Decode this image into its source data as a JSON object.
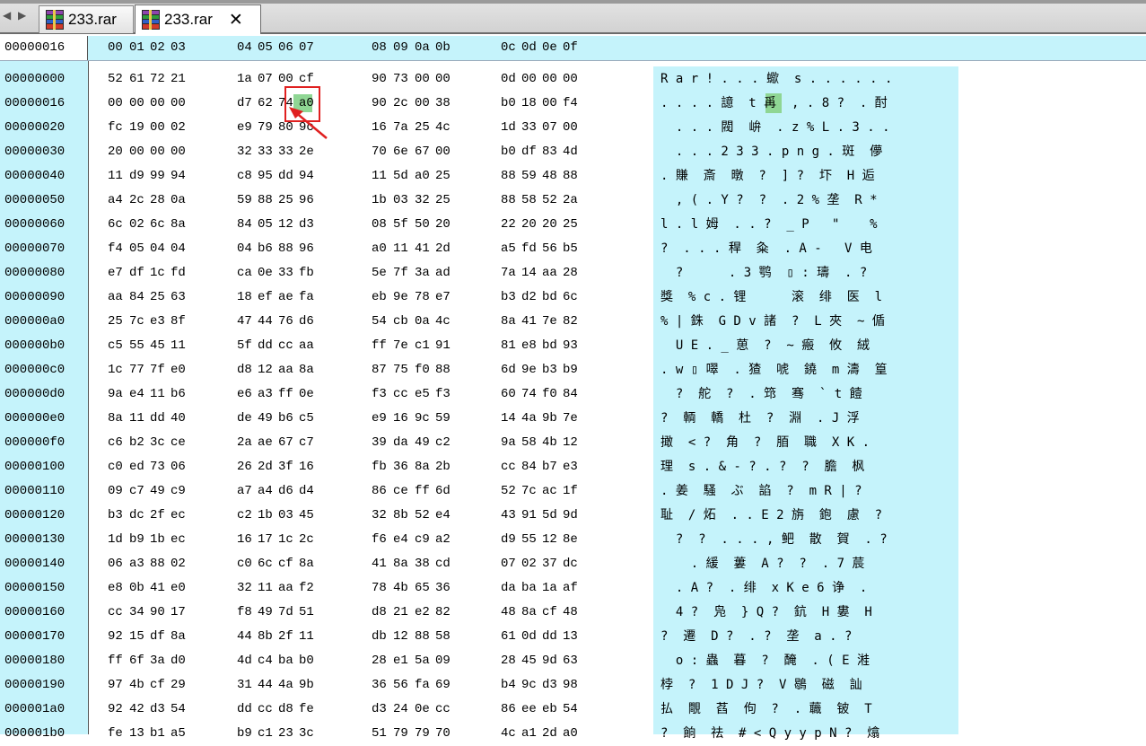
{
  "tabs": [
    {
      "label": "233.rar",
      "active": false
    },
    {
      "label": "233.rar",
      "active": true
    }
  ],
  "nav": {
    "back": "◀",
    "forward": "▶"
  },
  "close_glyph": "✕",
  "header": {
    "offset": "00000016",
    "columns": [
      "00",
      "01",
      "02",
      "03",
      "04",
      "05",
      "06",
      "07",
      "08",
      "09",
      "0a",
      "0b",
      "0c",
      "0d",
      "0e",
      "0f"
    ]
  },
  "rows": [
    {
      "offset": "00000000",
      "hex": [
        "52",
        "61",
        "72",
        "21",
        "1a",
        "07",
        "00",
        "cf",
        "90",
        "73",
        "00",
        "00",
        "0d",
        "00",
        "00",
        "00"
      ],
      "ascii": "R a r ! . . . 蠍  s . . . . . ."
    },
    {
      "offset": "00000016",
      "hex": [
        "00",
        "00",
        "00",
        "00",
        "d7",
        "62",
        "74",
        "a0",
        "90",
        "2c",
        "00",
        "38",
        "b0",
        "18",
        "00",
        "f4"
      ],
      "ascii": ". . . . 譩  t 爯  , . 8 ?  . 酎"
    },
    {
      "offset": "00000020",
      "hex": [
        "fc",
        "19",
        "00",
        "02",
        "e9",
        "79",
        "80",
        "9c",
        "16",
        "7a",
        "25",
        "4c",
        "1d",
        "33",
        "07",
        "00"
      ],
      "ascii": "  . . . 閥  峅  . z % L . 3 . ."
    },
    {
      "offset": "00000030",
      "hex": [
        "20",
        "00",
        "00",
        "00",
        "32",
        "33",
        "33",
        "2e",
        "70",
        "6e",
        "67",
        "00",
        "b0",
        "df",
        "83",
        "4d"
      ],
      "ascii": "  . . . 2 3 3 . p n g . 斑  儚"
    },
    {
      "offset": "00000040",
      "hex": [
        "11",
        "d9",
        "99",
        "94",
        "c8",
        "95",
        "dd",
        "94",
        "11",
        "5d",
        "a0",
        "25",
        "88",
        "59",
        "48",
        "88"
      ],
      "ascii": ". 賺  斎  暾  ?  ] ?  圷  H 逅"
    },
    {
      "offset": "00000050",
      "hex": [
        "a4",
        "2c",
        "28",
        "0a",
        "59",
        "88",
        "25",
        "96",
        "1b",
        "03",
        "32",
        "25",
        "88",
        "58",
        "52",
        "2a"
      ],
      "ascii": "  , ( . Y ?  ?  . 2 % 垄  R *"
    },
    {
      "offset": "00000060",
      "hex": [
        "6c",
        "02",
        "6c",
        "8a",
        "84",
        "05",
        "12",
        "d3",
        "08",
        "5f",
        "50",
        "20",
        "22",
        "20",
        "20",
        "25"
      ],
      "ascii": "l . l 姆  . . ?  _ P   \"    %"
    },
    {
      "offset": "00000070",
      "hex": [
        "f4",
        "05",
        "04",
        "04",
        "04",
        "b6",
        "88",
        "96",
        "a0",
        "11",
        "41",
        "2d",
        "a5",
        "fd",
        "56",
        "b5"
      ],
      "ascii": "?  . . . 稈  粂  . A -   V 电"
    },
    {
      "offset": "00000080",
      "hex": [
        "e7",
        "df",
        "1c",
        "fd",
        "ca",
        "0e",
        "33",
        "fb",
        "5e",
        "7f",
        "3a",
        "ad",
        "7a",
        "14",
        "aa",
        "28"
      ],
      "ascii": "  ?      . 3 鹗  ▯ : 璹  . ?"
    },
    {
      "offset": "00000090",
      "hex": [
        "aa",
        "84",
        "25",
        "63",
        "18",
        "ef",
        "ae",
        "fa",
        "eb",
        "9e",
        "78",
        "e7",
        "b3",
        "d2",
        "bd",
        "6c"
      ],
      "ascii": "獎  % c . 锂      滚  绯  医  l"
    },
    {
      "offset": "000000a0",
      "hex": [
        "25",
        "7c",
        "e3",
        "8f",
        "47",
        "44",
        "76",
        "d6",
        "54",
        "cb",
        "0a",
        "4c",
        "8a",
        "41",
        "7e",
        "82"
      ],
      "ascii": "% | 銖  G D v 諸  ?  L 夾  ~ 偱"
    },
    {
      "offset": "000000b0",
      "hex": [
        "c5",
        "55",
        "45",
        "11",
        "5f",
        "dd",
        "cc",
        "aa",
        "ff",
        "7e",
        "c1",
        "91",
        "81",
        "e8",
        "bd",
        "93"
      ],
      "ascii": "  U E . _ 葸  ?  ~ 瘢  攸  絨"
    },
    {
      "offset": "000000c0",
      "hex": [
        "1c",
        "77",
        "7f",
        "e0",
        "d8",
        "12",
        "aa",
        "8a",
        "87",
        "75",
        "f0",
        "88",
        "6d",
        "9e",
        "b3",
        "b9"
      ],
      "ascii": ". w ▯ 噿  . 猹  唬  鐃  m 濤  篁"
    },
    {
      "offset": "000000d0",
      "hex": [
        "9a",
        "e4",
        "11",
        "b6",
        "e6",
        "a3",
        "ff",
        "0e",
        "f3",
        "cc",
        "e5",
        "f3",
        "60",
        "74",
        "f0",
        "84"
      ],
      "ascii": "  ?  舵  ?  . 筇  骞  ` t 饐"
    },
    {
      "offset": "000000e0",
      "hex": [
        "8a",
        "11",
        "dd",
        "40",
        "de",
        "49",
        "b6",
        "c5",
        "e9",
        "16",
        "9c",
        "59",
        "14",
        "4a",
        "9b",
        "7e"
      ],
      "ascii": "?  輌  轎  杜  ?  淵  . J 浮"
    },
    {
      "offset": "000000f0",
      "hex": [
        "c6",
        "b2",
        "3c",
        "ce",
        "2a",
        "ae",
        "67",
        "c7",
        "39",
        "da",
        "49",
        "c2",
        "9a",
        "58",
        "4b",
        "12"
      ],
      "ascii": "撖  < ?  角  ?  脜  職  X K ."
    },
    {
      "offset": "00000100",
      "hex": [
        "c0",
        "ed",
        "73",
        "06",
        "26",
        "2d",
        "3f",
        "16",
        "fb",
        "36",
        "8a",
        "2b",
        "cc",
        "84",
        "b7",
        "e3"
      ],
      "ascii": "理  s . & - ? . ?  ?  膽  枫"
    },
    {
      "offset": "00000110",
      "hex": [
        "09",
        "c7",
        "49",
        "c9",
        "a7",
        "a4",
        "d6",
        "d4",
        "86",
        "ce",
        "ff",
        "6d",
        "52",
        "7c",
        "ac",
        "1f"
      ],
      "ascii": ". 姜  騷  ぶ  諂  ?  m R | ?"
    },
    {
      "offset": "00000120",
      "hex": [
        "b3",
        "dc",
        "2f",
        "ec",
        "c2",
        "1b",
        "03",
        "45",
        "32",
        "8b",
        "52",
        "e4",
        "43",
        "91",
        "5d",
        "9d"
      ],
      "ascii": "耻  / 炻  . . E 2 旃  鉋  慮  ?"
    },
    {
      "offset": "00000130",
      "hex": [
        "1d",
        "b9",
        "1b",
        "ec",
        "16",
        "17",
        "1c",
        "2c",
        "f6",
        "e4",
        "c9",
        "a2",
        "d9",
        "55",
        "12",
        "8e"
      ],
      "ascii": "  ?  ?  . . . , 鲃  散  賀  . ?"
    },
    {
      "offset": "00000140",
      "hex": [
        "06",
        "a3",
        "88",
        "02",
        "c0",
        "6c",
        "cf",
        "8a",
        "41",
        "8a",
        "38",
        "cd",
        "07",
        "02",
        "37",
        "dc"
      ],
      "ascii": "    . 緩  蔞  A ?  ?  . 7 莀"
    },
    {
      "offset": "00000150",
      "hex": [
        "e8",
        "0b",
        "41",
        "e0",
        "32",
        "11",
        "aa",
        "f2",
        "78",
        "4b",
        "65",
        "36",
        "da",
        "ba",
        "1a",
        "af"
      ],
      "ascii": "  . A ?  . 绯  x K e 6 诤  ."
    },
    {
      "offset": "00000160",
      "hex": [
        "cc",
        "34",
        "90",
        "17",
        "f8",
        "49",
        "7d",
        "51",
        "d8",
        "21",
        "e2",
        "82",
        "48",
        "8a",
        "cf",
        "48"
      ],
      "ascii": "  4 ?  凫  } Q ?  鈧  H 婁  H"
    },
    {
      "offset": "00000170",
      "hex": [
        "92",
        "15",
        "df",
        "8a",
        "44",
        "8b",
        "2f",
        "11",
        "db",
        "12",
        "88",
        "58",
        "61",
        "0d",
        "dd",
        "13"
      ],
      "ascii": "?  遷  D ?  . ?  垄  a . ?"
    },
    {
      "offset": "00000180",
      "hex": [
        "ff",
        "6f",
        "3a",
        "d0",
        "4d",
        "c4",
        "ba",
        "b0",
        "28",
        "e1",
        "5a",
        "09",
        "28",
        "45",
        "9d",
        "63"
      ],
      "ascii": "  o : 蟲  暮  ?  醃  . ( E 溎"
    },
    {
      "offset": "00000190",
      "hex": [
        "97",
        "4b",
        "cf",
        "29",
        "31",
        "44",
        "4a",
        "9b",
        "36",
        "56",
        "fa",
        "69",
        "b4",
        "9c",
        "d3",
        "98"
      ],
      "ascii": "桲  ?  1 D J ?  V 鶡  磁  訕"
    },
    {
      "offset": "000001a0",
      "hex": [
        "92",
        "42",
        "d3",
        "54",
        "dd",
        "cc",
        "d8",
        "fe",
        "d3",
        "24",
        "0e",
        "cc",
        "86",
        "ee",
        "eb",
        "54"
      ],
      "ascii": "払  覸  萏  佝  ?  . 蘵  铍  T"
    },
    {
      "offset": "000001b0",
      "hex": [
        "fe",
        "13",
        "b1",
        "a5",
        "b9",
        "c1",
        "23",
        "3c",
        "51",
        "79",
        "79",
        "70",
        "4c",
        "a1",
        "2d",
        "a0"
      ],
      "ascii": "?  餉  祛  # < Q y y p N ?  熻"
    }
  ]
}
